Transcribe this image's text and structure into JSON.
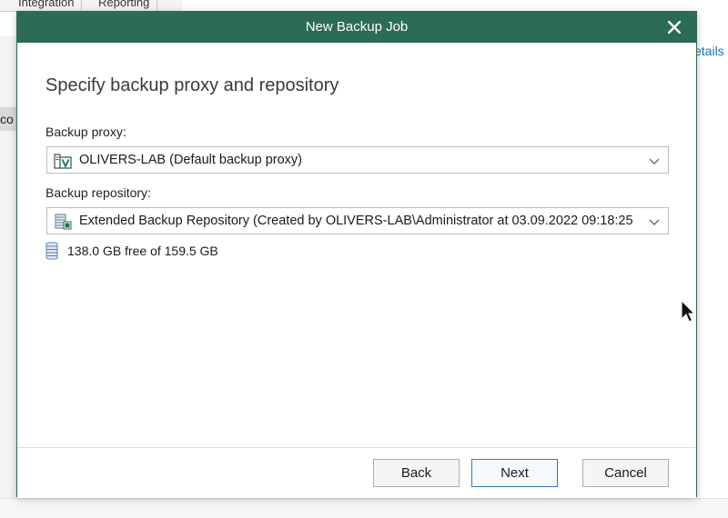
{
  "background": {
    "tabs": [
      "Integration",
      "Reporting"
    ],
    "left_item_text": "co",
    "right_link": "etails"
  },
  "dialog": {
    "title": "New Backup Job",
    "heading": "Specify backup proxy and repository",
    "proxy": {
      "label": "Backup proxy:",
      "value": "OLIVERS-LAB (Default backup proxy)"
    },
    "repository": {
      "label": "Backup repository:",
      "value": "Extended Backup Repository (Created by OLIVERS-LAB\\Administrator at 03.09.2022 09:18:25",
      "free_space": "138.0 GB free of 159.5 GB"
    },
    "buttons": {
      "back": "Back",
      "next": "Next",
      "cancel": "Cancel"
    }
  },
  "colors": {
    "titlebar": "#2c6b55",
    "primary_border": "#2f7bbf"
  }
}
